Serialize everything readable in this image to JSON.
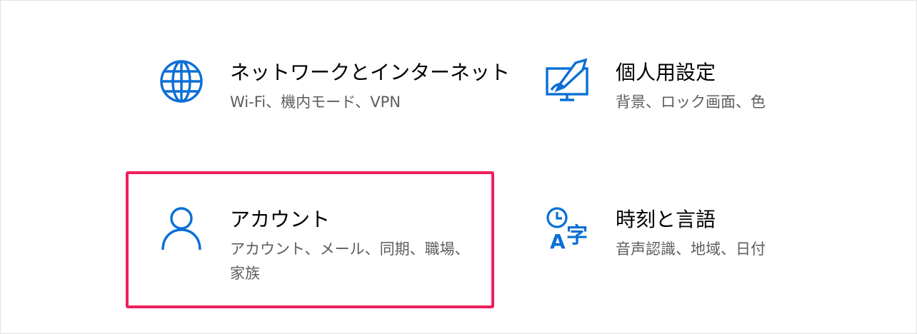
{
  "accent_color": "#0a6fd6",
  "highlight_color": "#ef1f5b",
  "tiles": [
    {
      "id": "network",
      "icon": "globe-icon",
      "title": "ネットワークとインターネット",
      "description": "Wi-Fi、機内モード、VPN"
    },
    {
      "id": "personalization",
      "icon": "personalization-icon",
      "title": "個人用設定",
      "description": "背景、ロック画面、色"
    },
    {
      "id": "accounts",
      "icon": "person-icon",
      "title": "アカウント",
      "description": "アカウント、メール、同期、職場、家族",
      "highlighted": true
    },
    {
      "id": "time-language",
      "icon": "time-language-icon",
      "title": "時刻と言語",
      "description": "音声認識、地域、日付"
    }
  ]
}
